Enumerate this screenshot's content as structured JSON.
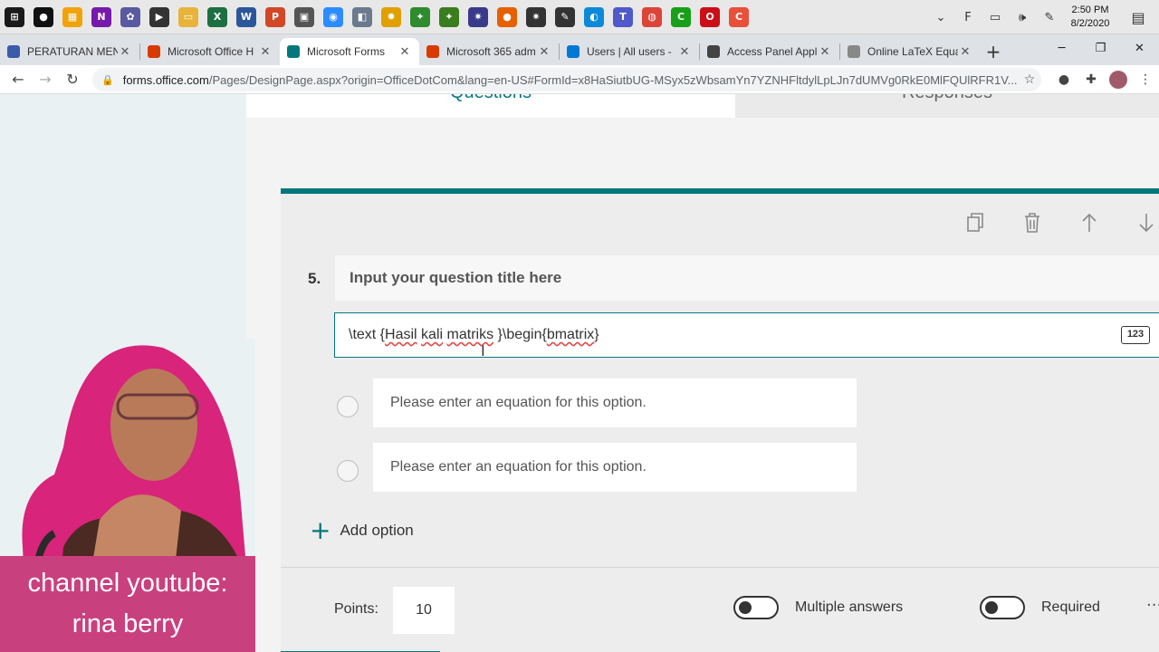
{
  "taskbar": {
    "icons": [
      {
        "name": "windows-start-icon",
        "glyph": "⊞",
        "color": "#1a1a1a"
      },
      {
        "name": "maps-icon",
        "glyph": "●",
        "color": "#111111"
      },
      {
        "name": "store-icon",
        "glyph": "▦",
        "color": "#f0a30a"
      },
      {
        "name": "onenote-icon",
        "glyph": "N",
        "color": "#7719aa"
      },
      {
        "name": "paint-icon",
        "glyph": "✿",
        "color": "#5a5aa0"
      },
      {
        "name": "video-editor-icon",
        "glyph": "▶",
        "color": "#333333"
      },
      {
        "name": "file-explorer-icon",
        "glyph": "▭",
        "color": "#e8b33a"
      },
      {
        "name": "excel-icon",
        "glyph": "X",
        "color": "#1d6f42"
      },
      {
        "name": "word-icon",
        "glyph": "W",
        "color": "#2b579a"
      },
      {
        "name": "powerpoint-icon",
        "glyph": "P",
        "color": "#d24726"
      },
      {
        "name": "calendar-icon",
        "glyph": "▣",
        "color": "#555555"
      },
      {
        "name": "zoom-icon",
        "glyph": "◉",
        "color": "#2d8cff"
      },
      {
        "name": "photos-icon",
        "glyph": "◧",
        "color": "#6b7a8c"
      },
      {
        "name": "app-yellow-icon",
        "glyph": "✹",
        "color": "#e0a000"
      },
      {
        "name": "pkg-icon",
        "glyph": "✦",
        "color": "#2e8b2e"
      },
      {
        "name": "pkg2-icon",
        "glyph": "✦",
        "color": "#3a7d1e"
      },
      {
        "name": "settings-cog-icon",
        "glyph": "✷",
        "color": "#3a3a8a"
      },
      {
        "name": "firefox-icon",
        "glyph": "●",
        "color": "#e66000"
      },
      {
        "name": "gear-app-icon",
        "glyph": "✷",
        "color": "#333333"
      },
      {
        "name": "pen-tool-icon",
        "glyph": "✎",
        "color": "#333333"
      },
      {
        "name": "edge-icon",
        "glyph": "◐",
        "color": "#0c8ad8"
      },
      {
        "name": "teams-icon",
        "glyph": "T",
        "color": "#5059c9"
      },
      {
        "name": "chrome-icon",
        "glyph": "◍",
        "color": "#db4437"
      },
      {
        "name": "camtasia-icon",
        "glyph": "C",
        "color": "#17a017"
      },
      {
        "name": "opera-icon",
        "glyph": "O",
        "color": "#cc0f16"
      },
      {
        "name": "recorder-icon",
        "glyph": "C",
        "color": "#e8503a"
      }
    ],
    "tray": [
      {
        "name": "tray-chevron-icon",
        "glyph": "⌄"
      },
      {
        "name": "tray-app-icon",
        "glyph": "F"
      },
      {
        "name": "battery-icon",
        "glyph": "▭"
      },
      {
        "name": "volume-icon",
        "glyph": "🕪"
      },
      {
        "name": "pen-icon",
        "glyph": "✎"
      }
    ],
    "time": "2:50 PM",
    "date": "8/2/2020",
    "notifications_glyph": "▤"
  },
  "browser": {
    "tabs": [
      {
        "title": "PERATURAN MEN",
        "favicon_color": "#3a5ba8",
        "active": false
      },
      {
        "title": "Microsoft Office H",
        "favicon_color": "#d83b01",
        "active": false
      },
      {
        "title": "Microsoft Forms",
        "favicon_color": "#03787c",
        "active": true
      },
      {
        "title": "Microsoft 365 adm",
        "favicon_color": "#d83b01",
        "active": false
      },
      {
        "title": "Users | All users - ",
        "favicon_color": "#0078d4",
        "active": false
      },
      {
        "title": "Access Panel Appl",
        "favicon_color": "#444444",
        "active": false
      },
      {
        "title": "Online LaTeX Equa",
        "favicon_color": "#888888",
        "active": false
      }
    ],
    "close_glyph": "✕",
    "new_tab_glyph": "+",
    "window_controls": [
      "─",
      "❐",
      "✕"
    ],
    "url_host": "forms.office.com",
    "url_path": "/Pages/DesignPage.aspx?origin=OfficeDotCom&lang=en-US#FormId=x8HaSiutbUG-MSyx5zWbsamYn7YZNHFltdylLpLJn7dUMVg0RkE0MlFQUlRFR1V...",
    "back_glyph": "←",
    "forward_glyph": "→",
    "reload_glyph": "↻",
    "lock_glyph": "🔒",
    "star_glyph": "☆",
    "menu_glyph": "⋮"
  },
  "forms": {
    "tab_questions": "Questions",
    "tab_responses": "Responses",
    "question_number": "5.",
    "question_title_placeholder": "Input your question title here",
    "equation_parts": [
      "\\text {",
      "Hasil",
      " ",
      "kali",
      " ",
      "matriks",
      " }\\begin{",
      "bmatrix",
      "}"
    ],
    "equation_badge": "123",
    "options": [
      "Please enter an equation for this option.",
      "Please enter an equation for this option."
    ],
    "add_option": "Add option",
    "points_label": "Points:",
    "points_value": "10",
    "multiple_answers": "Multiple answers",
    "required": "Required",
    "more_glyph": "···"
  },
  "overlay": {
    "caption_line1": "channel youtube:",
    "caption_line2": "rina berry"
  },
  "colors": {
    "forms_accent": "#03787c",
    "caption_bg": "#c9407f"
  }
}
